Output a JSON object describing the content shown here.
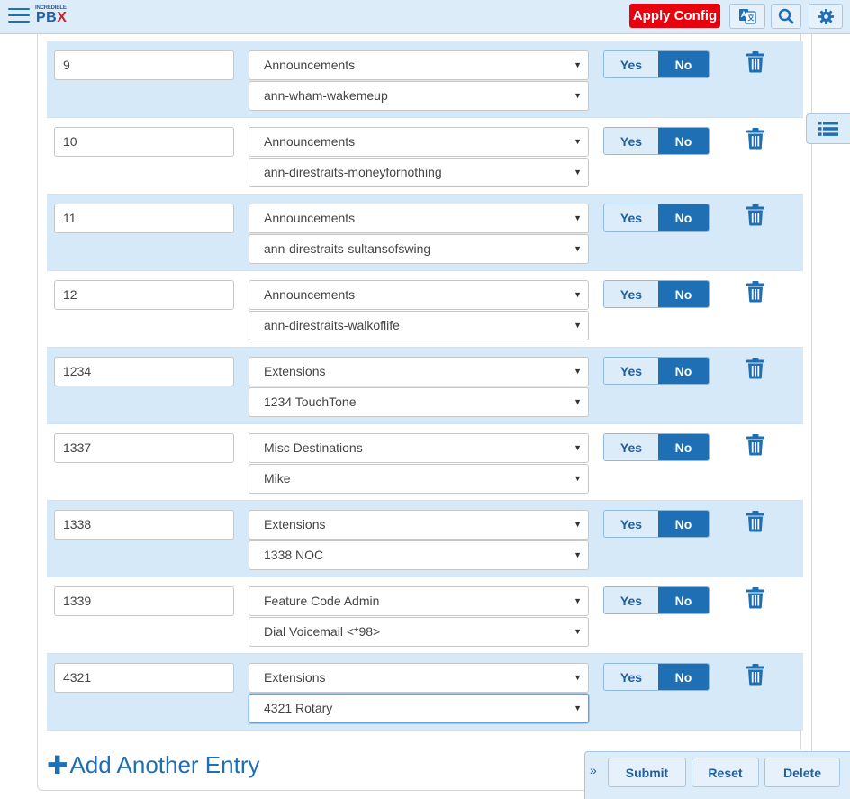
{
  "header": {
    "logo_small": "INCREDIBLE",
    "logo_main_a": "PB",
    "logo_main_b": "X",
    "apply_label": "Apply Config",
    "brand_blue": "#1f6fb5",
    "apply_red": "#e8000d"
  },
  "rows": [
    {
      "number": "9",
      "type": "Announcements",
      "target": "ann-wham-wakemeup",
      "yes": "Yes",
      "no": "No"
    },
    {
      "number": "10",
      "type": "Announcements",
      "target": "ann-direstraits-moneyfornothing",
      "yes": "Yes",
      "no": "No"
    },
    {
      "number": "11",
      "type": "Announcements",
      "target": "ann-direstraits-sultansofswing",
      "yes": "Yes",
      "no": "No"
    },
    {
      "number": "12",
      "type": "Announcements",
      "target": "ann-direstraits-walkoflife",
      "yes": "Yes",
      "no": "No"
    },
    {
      "number": "1234",
      "type": "Extensions",
      "target": "1234 TouchTone",
      "yes": "Yes",
      "no": "No"
    },
    {
      "number": "1337",
      "type": "Misc Destinations",
      "target": "Mike",
      "yes": "Yes",
      "no": "No"
    },
    {
      "number": "1338",
      "type": "Extensions",
      "target": "1338 NOC",
      "yes": "Yes",
      "no": "No"
    },
    {
      "number": "1339",
      "type": "Feature Code Admin",
      "target": "Dial Voicemail <*98>",
      "yes": "Yes",
      "no": "No"
    },
    {
      "number": "4321",
      "type": "Extensions",
      "target": "4321 Rotary",
      "yes": "Yes",
      "no": "No"
    }
  ],
  "add_entry_label": "Add Another Entry",
  "actions": {
    "chevron": "»",
    "submit": "Submit",
    "reset": "Reset",
    "delete": "Delete"
  }
}
